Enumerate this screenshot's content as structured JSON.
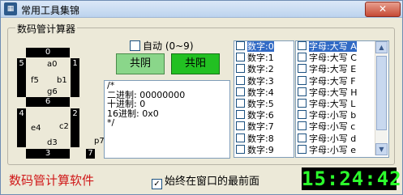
{
  "window": {
    "title": "常用工具集锦",
    "app_icon": "calc-icon",
    "close_label": "✕"
  },
  "group": {
    "label": "数码管计算器"
  },
  "segments": {
    "a": {
      "num": "0",
      "label": "a0"
    },
    "b": {
      "num": "1",
      "label": "b1"
    },
    "c": {
      "num": "2",
      "label": "c2"
    },
    "d": {
      "num": "3",
      "label": "d3"
    },
    "e": {
      "num": "4",
      "label": "e4"
    },
    "f": {
      "num": "5",
      "label": "f5"
    },
    "g": {
      "num": "6",
      "label": "g6"
    },
    "p": {
      "num": "7",
      "label": "p7"
    }
  },
  "controls": {
    "auto_label": "自动 (0~9)",
    "common_cathode": "共阴",
    "common_anode": "共阳"
  },
  "output": {
    "lines": [
      "/*",
      "二进制: 00000000",
      "十进制: 0",
      "16进制: 0x0",
      "*/"
    ]
  },
  "digits_list": [
    {
      "label": "数字:0",
      "selected": true
    },
    {
      "label": "数字:1",
      "selected": false
    },
    {
      "label": "数字:2",
      "selected": false
    },
    {
      "label": "数字:3",
      "selected": false
    },
    {
      "label": "数字:4",
      "selected": false
    },
    {
      "label": "数字:5",
      "selected": false
    },
    {
      "label": "数字:6",
      "selected": false
    },
    {
      "label": "数字:7",
      "selected": false
    },
    {
      "label": "数字:8",
      "selected": false
    },
    {
      "label": "数字:9",
      "selected": false
    }
  ],
  "letters_list": [
    {
      "label": "字母:大写 A",
      "selected": true
    },
    {
      "label": "字母:大写 C",
      "selected": false
    },
    {
      "label": "字母:大写 E",
      "selected": false
    },
    {
      "label": "字母:大写 F",
      "selected": false
    },
    {
      "label": "字母:大写 H",
      "selected": false
    },
    {
      "label": "字母:大写 L",
      "selected": false
    },
    {
      "label": "字母:小写 b",
      "selected": false
    },
    {
      "label": "字母:小写 c",
      "selected": false
    },
    {
      "label": "字母:小写 d",
      "selected": false
    },
    {
      "label": "字母:小写 e",
      "selected": false
    }
  ],
  "footer": {
    "app_name": "数码管计算软件",
    "always_on_top": "始终在窗口的最前面",
    "always_on_top_checked": true,
    "clock": "15:24:42"
  },
  "colors": {
    "app_name": "#d01818",
    "clock_text": "#2cff2c",
    "selected_row": "#316ac5"
  }
}
